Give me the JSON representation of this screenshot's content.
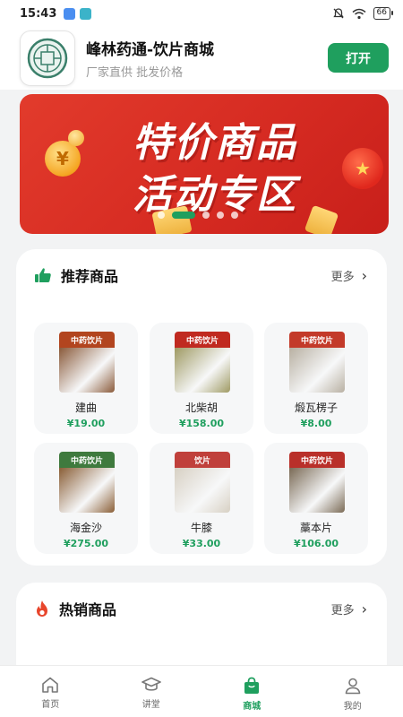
{
  "status_bar": {
    "time": "15:43",
    "battery": "66"
  },
  "app": {
    "name": "峰林药通-饮片商城",
    "subtitle": "厂家直供 批发价格",
    "open_label": "打开"
  },
  "banner": {
    "line1": "特价商品",
    "line2": "活动专区",
    "coin_glyph": "¥",
    "ball_glyph": "★",
    "slide_count": 5,
    "active_slide": 1
  },
  "recommended": {
    "title": "推荐商品",
    "more_label": "更多",
    "items": [
      {
        "name": "建曲",
        "price": "¥19.00",
        "label": "中药饮片",
        "label_color": "#b2451f",
        "body_color": "#8a5a3a"
      },
      {
        "name": "北柴胡",
        "price": "¥158.00",
        "label": "中药饮片",
        "label_color": "#c02a20",
        "body_color": "#9f9a63"
      },
      {
        "name": "煅瓦楞子",
        "price": "¥8.00",
        "label": "中药饮片",
        "label_color": "#c33a2a",
        "body_color": "#b8b0a2"
      },
      {
        "name": "海金沙",
        "price": "¥275.00",
        "label": "中药饮片",
        "label_color": "#3f7a3e",
        "body_color": "#8a5e36"
      },
      {
        "name": "牛膝",
        "price": "¥33.00",
        "label": "饮片",
        "label_color": "#c0403b",
        "body_color": "#d7d0c3"
      },
      {
        "name": "藁本片",
        "price": "¥106.00",
        "label": "中药饮片",
        "label_color": "#b9302a",
        "body_color": "#7a6a55"
      }
    ]
  },
  "hot": {
    "title": "热销商品",
    "more_label": "更多"
  },
  "nav": {
    "items": [
      {
        "label": "首页"
      },
      {
        "label": "讲堂"
      },
      {
        "label": "商城"
      },
      {
        "label": "我的"
      }
    ],
    "active_index": 2
  },
  "colors": {
    "accent": "#1f9f5e",
    "banner_red": "#d62b22",
    "hot_icon": "#e8452b"
  }
}
